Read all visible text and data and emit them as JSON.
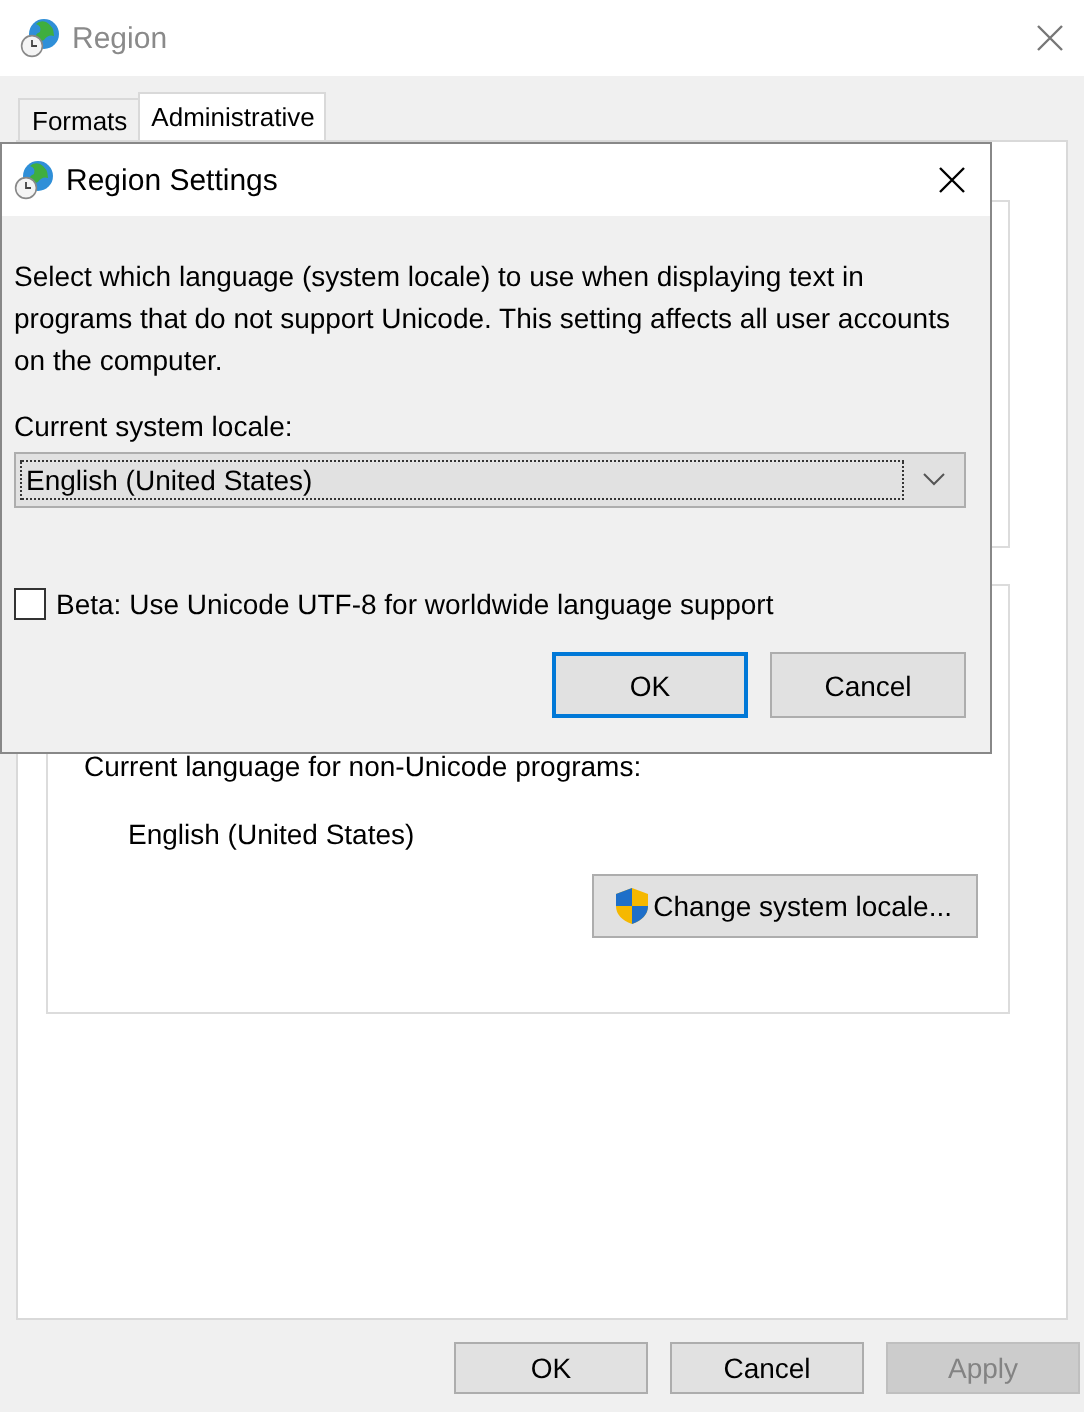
{
  "window": {
    "title": "Region"
  },
  "tabs": [
    {
      "label": "Formats",
      "selected": false
    },
    {
      "label": "Administrative",
      "selected": true
    }
  ],
  "panel": {
    "label": "Current language for non-Unicode programs:",
    "value": "English (United States)",
    "button": "Change system locale..."
  },
  "buttons": [
    {
      "label": "OK",
      "disabled": false
    },
    {
      "label": "Cancel",
      "disabled": false
    },
    {
      "label": "Apply",
      "disabled": true
    }
  ],
  "dialog": {
    "title": "Region Settings",
    "description": "Select which language (system locale) to use when displaying text in programs that do not support Unicode. This setting affects all user accounts on the computer.",
    "locale_label": "Current system locale:",
    "locale_value": "English (United States)",
    "checkbox": {
      "label": "Beta: Use Unicode UTF-8 for worldwide language support",
      "checked": false
    },
    "buttons": [
      {
        "label": "OK",
        "default": true
      },
      {
        "label": "Cancel",
        "default": false
      }
    ]
  }
}
